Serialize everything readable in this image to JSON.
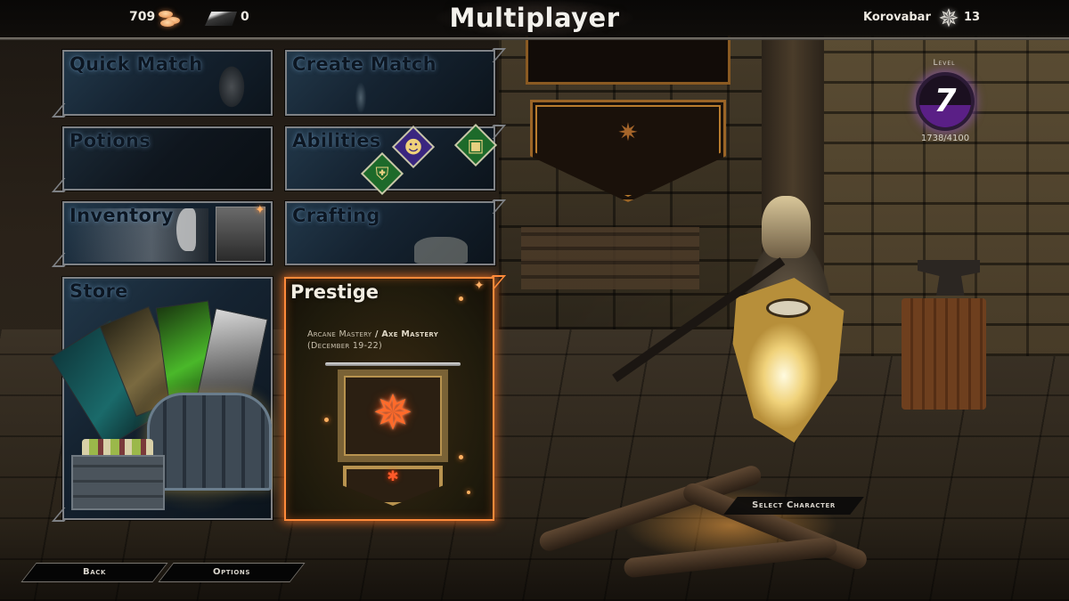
{
  "header": {
    "title": "Multiplayer",
    "currencies": [
      {
        "name": "gold-coins",
        "icon": "coins-icon",
        "value": "709"
      },
      {
        "name": "platinum-ingot",
        "icon": "ingot-icon",
        "value": "0"
      }
    ],
    "player": {
      "name": "Korovabar",
      "rank_icon": "inquisition-sigil-icon",
      "rank_value": "13"
    }
  },
  "level": {
    "label": "Level",
    "value": "7",
    "xp_current": 1738,
    "xp_required": 4100,
    "xp_text": "1738/4100",
    "accent_color": "#5a1f86"
  },
  "tiles": [
    {
      "id": "quick-match",
      "label": "Quick Match"
    },
    {
      "id": "create-match",
      "label": "Create Match"
    },
    {
      "id": "potions",
      "label": "Potions"
    },
    {
      "id": "abilities",
      "label": "Abilities"
    },
    {
      "id": "inventory",
      "label": "Inventory",
      "badge": "new-item-sparkle"
    },
    {
      "id": "crafting",
      "label": "Crafting"
    },
    {
      "id": "store",
      "label": "Store"
    }
  ],
  "prestige": {
    "title": "Prestige",
    "line1_a": "Arcane Mastery",
    "line1_sep": " / ",
    "line1_b": "Axe Mastery",
    "line2": "(December 19-22)",
    "emblem": "inquisition-sunburst-icon",
    "accent_color": "#ff8a3a"
  },
  "buttons": {
    "back": "Back",
    "options": "Options",
    "select_character": "Select Character"
  }
}
